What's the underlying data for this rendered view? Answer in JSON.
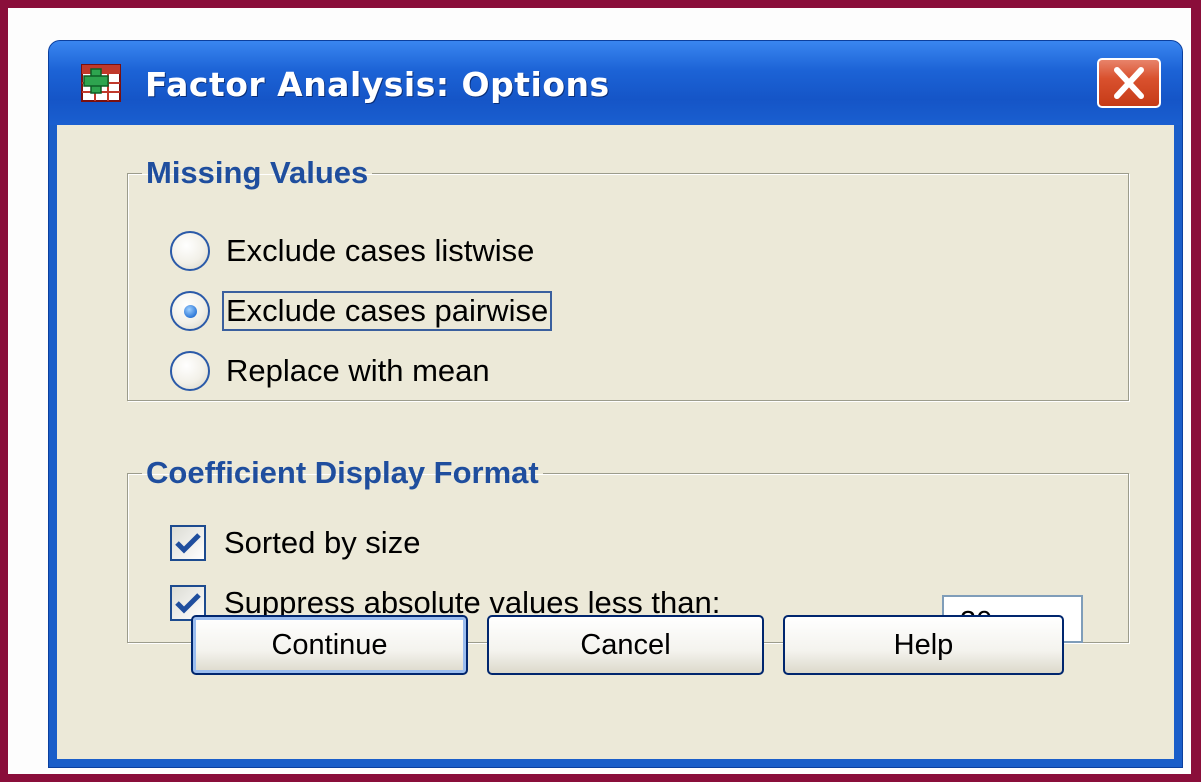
{
  "window": {
    "title": "Factor Analysis: Options",
    "icon": "spss-table-icon",
    "close_icon": "close-icon"
  },
  "missing_values": {
    "legend": "Missing Values",
    "options": [
      {
        "label": "Exclude cases listwise",
        "selected": false
      },
      {
        "label": "Exclude cases pairwise",
        "selected": true
      },
      {
        "label": "Replace with mean",
        "selected": false
      }
    ]
  },
  "coefficient_display": {
    "legend": "Coefficient Display Format",
    "sorted_by_size": {
      "label": "Sorted by size",
      "checked": true
    },
    "suppress": {
      "label": "Suppress absolute values less than:",
      "checked": true,
      "value": ".30"
    }
  },
  "buttons": {
    "continue": "Continue",
    "cancel": "Cancel",
    "help": "Help"
  },
  "colors": {
    "outer_border": "#8a0e3a",
    "title_bar": "#1c63d6",
    "legend_text": "#1f4e9e",
    "dialog_background": "#ece9d8"
  }
}
